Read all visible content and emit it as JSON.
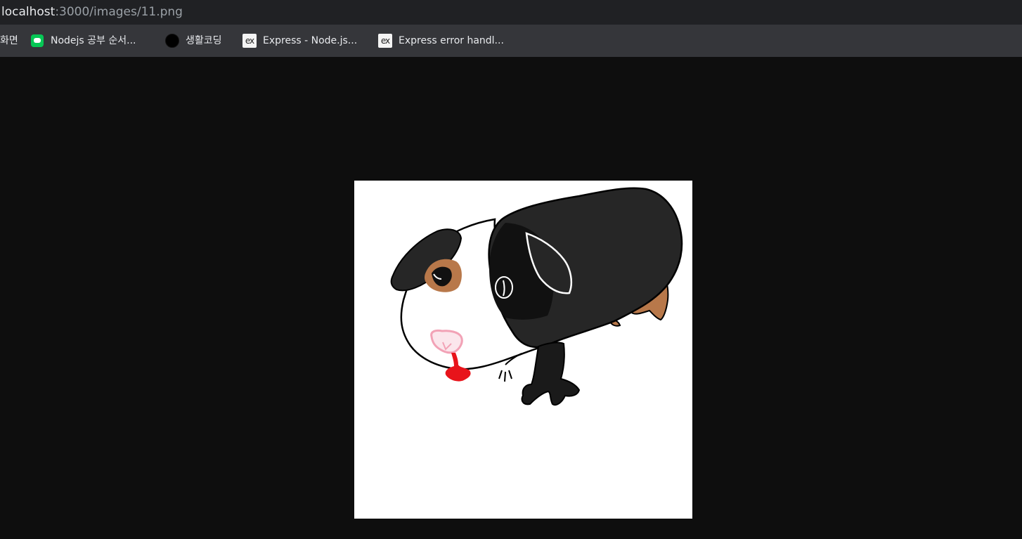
{
  "address_bar": {
    "host": "localhost",
    "path": ":3000/images/11.png"
  },
  "bookmarks": [
    {
      "label": "화면",
      "icon": "none"
    },
    {
      "label": "Nodejs 공부 순서...",
      "icon": "line-chat-icon"
    },
    {
      "label": "생활코딩",
      "icon": "black-circle-icon"
    },
    {
      "label": "Express - Node.js...",
      "icon": "express-ex-icon",
      "icon_text": "ex"
    },
    {
      "label": "Express error handl...",
      "icon": "express-ex-icon",
      "icon_text": "ex"
    }
  ],
  "image": {
    "subject": "hand-drawn guinea pig",
    "colors": {
      "background": "#ffffff",
      "fur_black": "#262626",
      "eye_patch": "#b8784a",
      "leg": "#b8784a",
      "nose": "#f2b6c6",
      "tongue": "#e8141b"
    }
  },
  "colors": {
    "address_bar_bg": "#202124",
    "bookmark_bar_bg": "#35363a",
    "viewer_bg": "#0e0e0e"
  }
}
